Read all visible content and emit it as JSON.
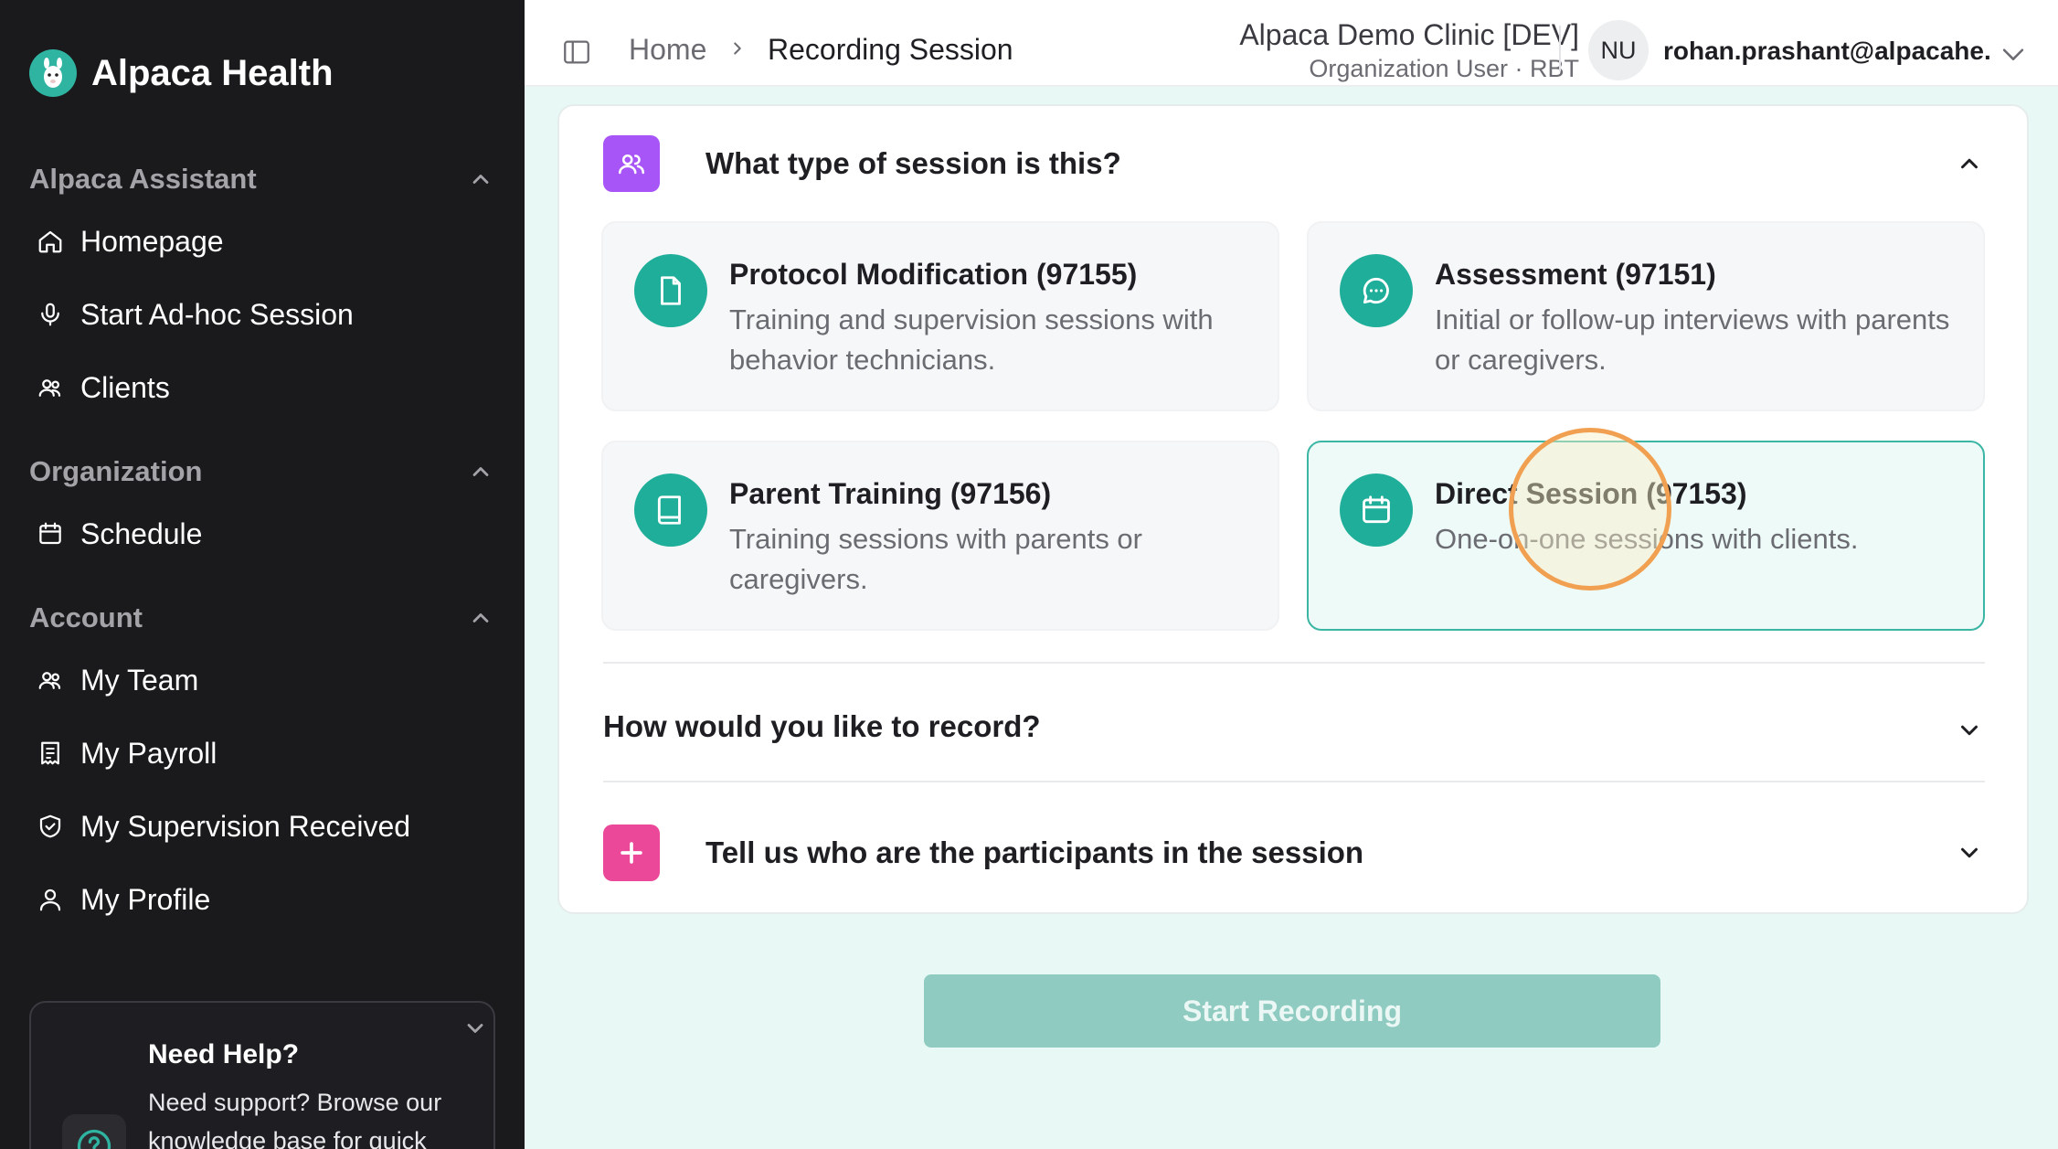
{
  "brand": {
    "name": "Alpaca Health"
  },
  "sidebar": {
    "sections": [
      {
        "title": "Alpaca Assistant",
        "items": [
          {
            "label": "Homepage",
            "icon": "home-icon"
          },
          {
            "label": "Start Ad-hoc Session",
            "icon": "microphone-icon"
          },
          {
            "label": "Clients",
            "icon": "users-icon"
          }
        ]
      },
      {
        "title": "Organization",
        "items": [
          {
            "label": "Schedule",
            "icon": "calendar-icon"
          }
        ]
      },
      {
        "title": "Account",
        "items": [
          {
            "label": "My Team",
            "icon": "users-icon"
          },
          {
            "label": "My Payroll",
            "icon": "receipt-icon"
          },
          {
            "label": "My Supervision Received",
            "icon": "shield-icon"
          },
          {
            "label": "My Profile",
            "icon": "user-icon"
          }
        ]
      }
    ],
    "help": {
      "title": "Need Help?",
      "body": "Need support? Browse our knowledge base for quick"
    }
  },
  "header": {
    "breadcrumb_home": "Home",
    "breadcrumb_current": "Recording Session",
    "org_name": "Alpaca Demo Clinic [DEV]",
    "org_role": "Organization User · RBT",
    "avatar_initials": "NU",
    "user_email": "rohan.prashant@alpacahe..."
  },
  "session_type": {
    "question": "What type of session is this?",
    "options": [
      {
        "title": "Protocol Modification (97155)",
        "description": "Training and supervision sessions with behavior technicians.",
        "icon": "document-icon",
        "selected": false
      },
      {
        "title": "Assessment (97151)",
        "description": "Initial or follow-up interviews with parents or caregivers.",
        "icon": "chat-bubble-icon",
        "selected": false
      },
      {
        "title": "Parent Training (97156)",
        "description": "Training sessions with parents or caregivers.",
        "icon": "book-icon",
        "selected": false
      },
      {
        "title": "Direct Session (97153)",
        "description": "One-on-one sessions with clients.",
        "icon": "calendar-icon",
        "selected": true
      }
    ]
  },
  "record_question": "How would you like to record?",
  "participants_question": "Tell us who are the participants in the session",
  "start_button": "Start Recording",
  "colors": {
    "sidebar_bg": "#1a1a1c",
    "accent_teal": "#1fae99",
    "session_icon_purple": "#a855f7",
    "participants_icon_pink": "#ec4899",
    "start_button_disabled": "#8fcbc1",
    "cursor_highlight": "#f0a050"
  }
}
